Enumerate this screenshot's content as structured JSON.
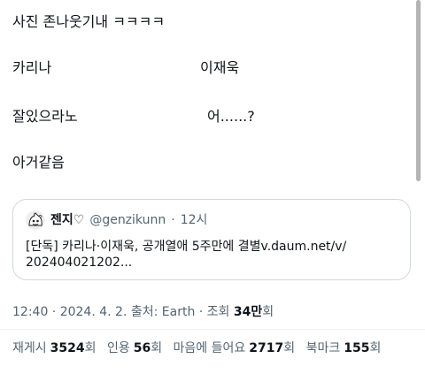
{
  "tweet": {
    "lines": [
      "사진 존나웃기내 ㅋㅋㅋㅋ",
      "카리나",
      "이재욱",
      "잘있으라노",
      "어......?",
      "아거같음"
    ]
  },
  "quote": {
    "name": "젠지♡",
    "handle": "@genzikunn",
    "separator": "·",
    "time": "12시",
    "text_line1": "[단독] 카리나·이재욱, 공개열애 5주만에 결별v.daum.net/v/",
    "text_line2": "202404021202..."
  },
  "meta": {
    "prefix": "12:40 · 2024. 4. 2. 출처: Earth · 조회 ",
    "views": "34만",
    "suffix": "회"
  },
  "stats": {
    "retweet_label": "재게시",
    "retweet_count": "3524",
    "quote_label": "인용",
    "quote_count": "56",
    "like_label": "마음에 들어요",
    "like_count": "2717",
    "bookmark_label": "북마크",
    "bookmark_count": "155",
    "unit": "회"
  }
}
